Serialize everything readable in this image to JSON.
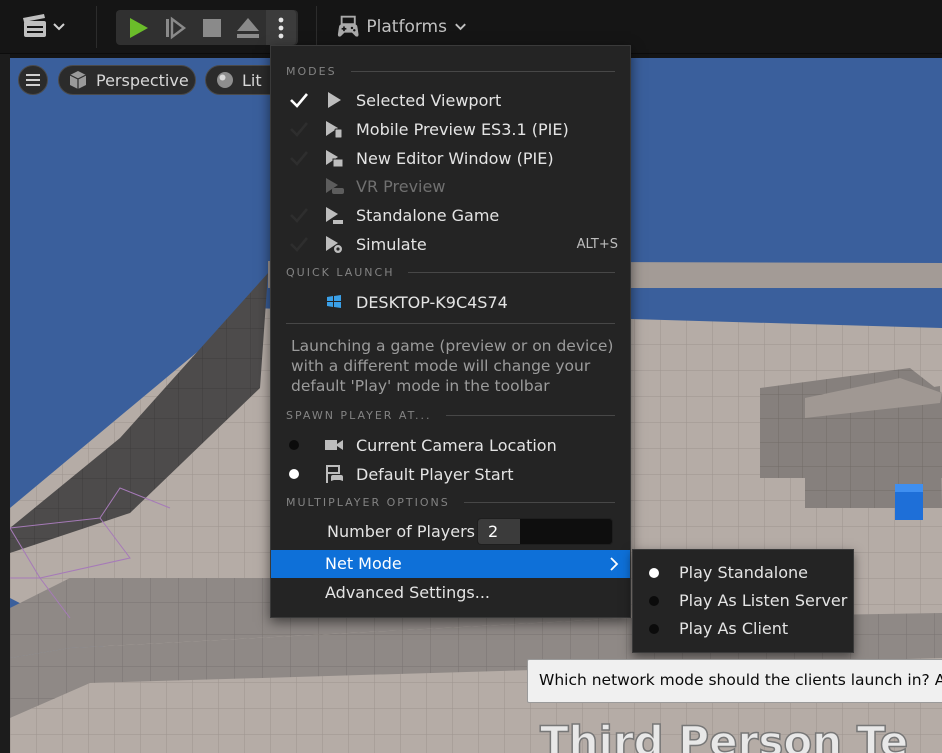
{
  "toolbar": {
    "platforms_label": "Platforms"
  },
  "viewport": {
    "perspective_label": "Perspective",
    "lit_label": "Lit",
    "world_text": "Third Person Te"
  },
  "menu": {
    "sections": {
      "modes": "MODES",
      "quick_launch": "QUICK LAUNCH",
      "spawn": "SPAWN PLAYER AT...",
      "multiplayer": "MULTIPLAYER OPTIONS"
    },
    "modes": [
      {
        "label": "Selected Viewport",
        "checked": true,
        "enabled": true
      },
      {
        "label": "Mobile Preview ES3.1 (PIE)",
        "checked": false,
        "enabled": true
      },
      {
        "label": "New Editor Window (PIE)",
        "checked": false,
        "enabled": true
      },
      {
        "label": "VR Preview",
        "checked": false,
        "enabled": false
      },
      {
        "label": "Standalone Game",
        "checked": false,
        "enabled": true
      },
      {
        "label": "Simulate",
        "checked": false,
        "enabled": true,
        "shortcut": "ALT+S"
      }
    ],
    "quick_launch": {
      "label": "DESKTOP-K9C4S74"
    },
    "info": "Launching a game (preview or on device) with a different mode will change your default 'Play' mode in the toolbar",
    "spawn": [
      {
        "label": "Current Camera Location",
        "selected": false
      },
      {
        "label": "Default Player Start",
        "selected": true
      }
    ],
    "players_label": "Number of Players",
    "players_value": "2",
    "net_mode_label": "Net Mode",
    "advanced_label": "Advanced Settings..."
  },
  "submenu": {
    "items": [
      {
        "label": "Play Standalone",
        "selected": true
      },
      {
        "label": "Play As Listen Server",
        "selected": false
      },
      {
        "label": "Play As Client",
        "selected": false
      }
    ]
  },
  "tooltip": {
    "text": "Which network mode should the clients launch in? A serve"
  },
  "colors": {
    "accent": "#0e70d8",
    "play_green": "#6bbd2a",
    "sky_blue": "#3a5f9c"
  },
  "icons": {
    "cinematics": "clapperboard-icon",
    "play": "play-icon",
    "skip": "frame-skip-icon",
    "stop": "stop-icon",
    "eject": "eject-icon",
    "more": "vertical-dots-icon",
    "platforms": "gamepad-icon"
  }
}
